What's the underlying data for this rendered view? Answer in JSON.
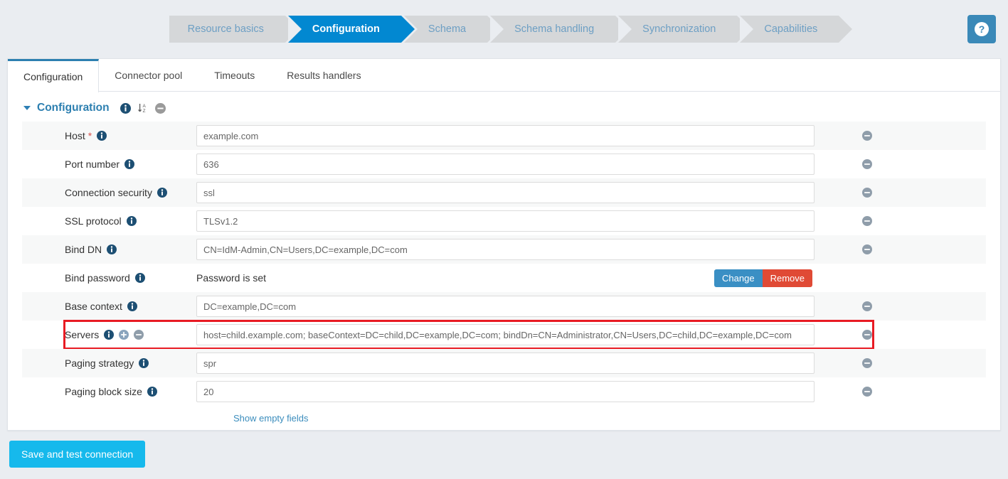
{
  "wizard": {
    "steps": [
      {
        "label": "Resource basics",
        "active": false
      },
      {
        "label": "Configuration",
        "active": true
      },
      {
        "label": "Schema",
        "active": false
      },
      {
        "label": "Schema handling",
        "active": false
      },
      {
        "label": "Synchronization",
        "active": false
      },
      {
        "label": "Capabilities",
        "active": false
      }
    ],
    "help_icon": "question-mark-circle-icon",
    "active_color": "#0288d1",
    "inactive_color": "#d5d7d9"
  },
  "tabs": [
    {
      "label": "Configuration",
      "active": true
    },
    {
      "label": "Connector pool",
      "active": false
    },
    {
      "label": "Timeouts",
      "active": false
    },
    {
      "label": "Results handlers",
      "active": false
    }
  ],
  "section": {
    "title": "Configuration",
    "caret_icon": "chevron-down-icon",
    "info_icon": "info-icon",
    "sort_icon": "sort-alpha-icon",
    "remove_icon": "minus-circle-icon",
    "title_color": "#2c7fb0"
  },
  "form": {
    "rows": [
      {
        "label": "Host",
        "required": true,
        "value": "example.com",
        "type": "input",
        "has_remove": true
      },
      {
        "label": "Port number",
        "required": false,
        "value": "636",
        "type": "input",
        "has_remove": true
      },
      {
        "label": "Connection security",
        "required": false,
        "value": "ssl",
        "type": "input",
        "has_remove": true
      },
      {
        "label": "SSL protocol",
        "required": false,
        "value": "TLSv1.2",
        "type": "input",
        "has_remove": true
      },
      {
        "label": "Bind DN",
        "required": false,
        "value": "CN=IdM-Admin,CN=Users,DC=example,DC=com",
        "type": "input",
        "has_remove": true
      },
      {
        "label": "Bind password",
        "required": false,
        "value": "Password is set",
        "type": "text",
        "has_remove": false
      },
      {
        "label": "Base context",
        "required": false,
        "value": "DC=example,DC=com",
        "type": "input",
        "has_remove": true
      },
      {
        "label": "Servers",
        "required": false,
        "value": "host=child.example.com; baseContext=DC=child,DC=example,DC=com; bindDn=CN=Administrator,CN=Users,DC=child,DC=example,DC=com",
        "type": "input",
        "has_remove": true,
        "highlighted": true,
        "has_add": true,
        "has_row_remove": true
      },
      {
        "label": "Paging strategy",
        "required": false,
        "value": "spr",
        "type": "input",
        "has_remove": true
      },
      {
        "label": "Paging block size",
        "required": false,
        "value": "20",
        "type": "input",
        "has_remove": true
      }
    ],
    "password_buttons": {
      "change_label": "Change",
      "remove_label": "Remove",
      "change_color": "#3a8fc4",
      "remove_color": "#e04a35"
    },
    "show_empty_fields_label": "Show empty fields",
    "add_icon": "plus-circle-icon",
    "remove_icon": "minus-circle-icon",
    "info_icon": "info-icon",
    "highlight_color": "#e81b23"
  },
  "footer": {
    "save_label": "Save and test connection",
    "save_color": "#16b9ec"
  }
}
